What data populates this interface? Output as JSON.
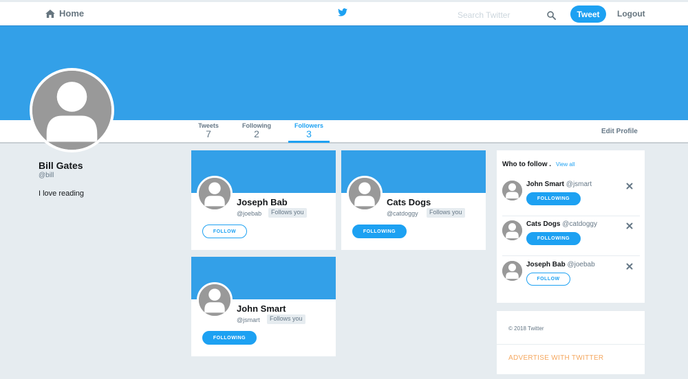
{
  "nav": {
    "home_label": "Home",
    "search_placeholder": "Search Twitter",
    "tweet_label": "Tweet",
    "logout_label": "Logout"
  },
  "profile_nav": {
    "tabs": [
      {
        "label": "Tweets",
        "count": "7"
      },
      {
        "label": "Following",
        "count": "2"
      },
      {
        "label": "Followers",
        "count": "3"
      }
    ],
    "active_tab": "Followers",
    "edit_label": "Edit Profile"
  },
  "profile": {
    "name": "Bill Gates",
    "handle": "@bill",
    "bio": "I love reading"
  },
  "followers": [
    {
      "name": "Joseph Bab",
      "handle": "@joebab",
      "follows_you": "Follows you",
      "button": "FOLLOW"
    },
    {
      "name": "Cats Dogs",
      "handle": "@catdoggy",
      "follows_you": "Follows you",
      "button": "FOLLOWING"
    },
    {
      "name": "John Smart",
      "handle": "@jsmart",
      "follows_you": "Follows you",
      "button": "FOLLOWING"
    }
  ],
  "who_to_follow": {
    "title": "Who to follow .",
    "view_all": "View all",
    "users": [
      {
        "name": "John Smart",
        "handle": "@jsmart",
        "button": "FOLLOWING"
      },
      {
        "name": "Cats Dogs",
        "handle": "@catdoggy",
        "button": "FOLLOWING"
      },
      {
        "name": "Joseph Bab",
        "handle": "@joebab",
        "button": "FOLLOW"
      }
    ]
  },
  "footer": {
    "copyright": "© 2018 Twitter",
    "advertise": "ADVERTISE WITH TWITTER"
  },
  "colors": {
    "brand_blue": "#1da1f2",
    "banner_blue": "#33a0e8",
    "background": "#e6ecf0",
    "advertise_orange": "#f5a860"
  },
  "icons": [
    "home-icon",
    "twitter-bird-icon",
    "search-icon",
    "avatar-placeholder-icon",
    "close-icon"
  ]
}
